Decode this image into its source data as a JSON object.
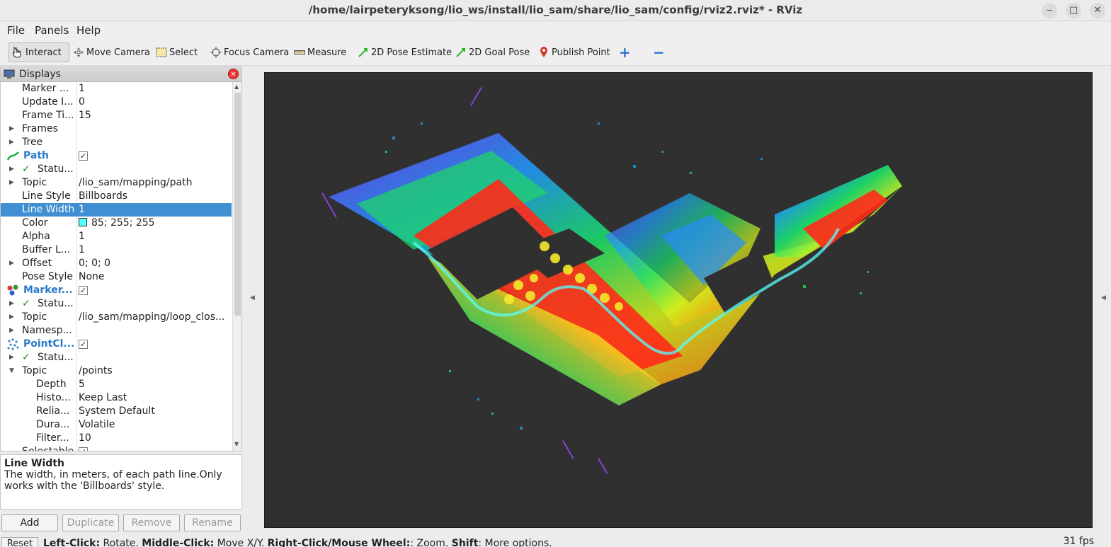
{
  "window": {
    "title": "/home/lairpeteryksong/lio_ws/install/lio_sam/share/lio_sam/config/rviz2.rviz* - RViz",
    "minimize": "⎯",
    "maximize": "□",
    "close": "✕"
  },
  "menu": [
    "File",
    "Panels",
    "Help"
  ],
  "toolbar": {
    "interact": "Interact",
    "move_camera": "Move Camera",
    "select": "Select",
    "focus_camera": "Focus Camera",
    "measure": "Measure",
    "pose_estimate": "2D Pose Estimate",
    "goal_pose": "2D Goal Pose",
    "publish_point": "Publish Point",
    "add": "+",
    "remove": "−"
  },
  "displays": {
    "title": "Displays",
    "rows": [
      {
        "label": "Marker ...",
        "value": "1"
      },
      {
        "label": "Update I...",
        "value": "0"
      },
      {
        "label": "Frame Ti...",
        "value": "15"
      },
      {
        "label": "Frames",
        "value": ""
      },
      {
        "label": "Tree",
        "value": ""
      },
      {
        "label": "Path",
        "value": "✓"
      },
      {
        "label": "Statu...",
        "value": ""
      },
      {
        "label": "Topic",
        "value": "/lio_sam/mapping/path"
      },
      {
        "label": "Line Style",
        "value": "Billboards"
      },
      {
        "label": "Line Width",
        "value": "1"
      },
      {
        "label": "Color",
        "value": "85; 255; 255"
      },
      {
        "label": "Alpha",
        "value": "1"
      },
      {
        "label": "Buffer L...",
        "value": "1"
      },
      {
        "label": "Offset",
        "value": "0; 0; 0"
      },
      {
        "label": "Pose Style",
        "value": "None"
      },
      {
        "label": "Marker...",
        "value": "✓"
      },
      {
        "label": "Statu...",
        "value": ""
      },
      {
        "label": "Topic",
        "value": "/lio_sam/mapping/loop_clos..."
      },
      {
        "label": "Namesp...",
        "value": ""
      },
      {
        "label": "PointCl...",
        "value": "✓"
      },
      {
        "label": "Statu...",
        "value": ""
      },
      {
        "label": "Topic",
        "value": "/points"
      },
      {
        "label": "Depth",
        "value": "5"
      },
      {
        "label": "Histo...",
        "value": "Keep Last"
      },
      {
        "label": "Relia...",
        "value": "System Default"
      },
      {
        "label": "Dura...",
        "value": "Volatile"
      },
      {
        "label": "Filter...",
        "value": "10"
      },
      {
        "label": "Selectable",
        "value": "✓"
      }
    ],
    "path_color": "#55ffff"
  },
  "description": {
    "title": "Line Width",
    "text": "The width, in meters, of each path line.Only works with the 'Billboards' style."
  },
  "buttons": {
    "add": "Add",
    "duplicate": "Duplicate",
    "remove": "Remove",
    "rename": "Rename"
  },
  "status": {
    "reset": "Reset",
    "hint_parts": [
      {
        "b": "Left-Click:",
        "t": " Rotate. "
      },
      {
        "b": "Middle-Click:",
        "t": " Move X/Y. "
      },
      {
        "b": "Right-Click/Mouse Wheel:",
        "t": ": Zoom. "
      },
      {
        "b": "Shift",
        "t": ": More options."
      }
    ],
    "fps": "31 fps"
  }
}
